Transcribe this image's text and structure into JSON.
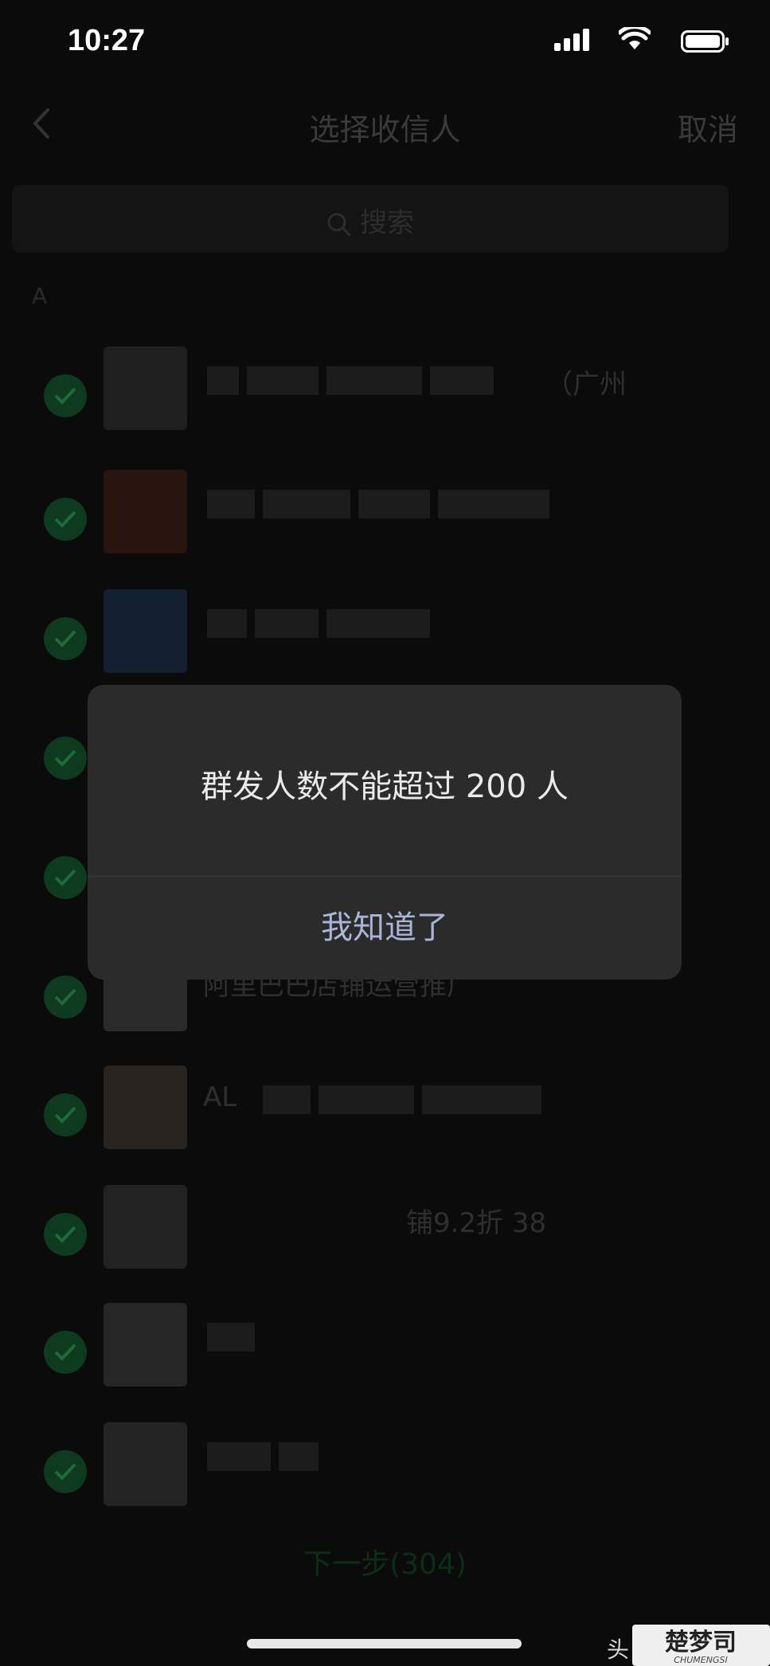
{
  "status": {
    "time": "10:27",
    "icons": [
      "cellular-signal-icon",
      "wifi-icon",
      "battery-icon"
    ]
  },
  "nav": {
    "title": "选择收信人",
    "cancel": "取消",
    "back_icon": "chevron-left-icon"
  },
  "search": {
    "placeholder": "搜索",
    "icon": "search-icon"
  },
  "section_letter": "A",
  "contacts": [
    {
      "name": "（广州",
      "checked": true
    },
    {
      "name": "",
      "checked": true
    },
    {
      "name": "",
      "checked": true
    },
    {
      "name": "",
      "checked": true
    },
    {
      "name": "",
      "checked": true
    },
    {
      "name": "阿里巴巴店铺运营推广",
      "checked": true
    },
    {
      "name": "AL",
      "checked": true
    },
    {
      "name": "铺9.2折 38",
      "checked": true
    },
    {
      "name": "",
      "checked": true
    },
    {
      "name": "",
      "checked": true
    }
  ],
  "next_step": "下一步(304)",
  "dialog": {
    "message": "群发人数不能超过 200 人",
    "button": "我知道了"
  },
  "watermark": {
    "toutiao": "头",
    "logo_text": "楚梦司",
    "logo_sub": "CHUMENGSI"
  },
  "colors": {
    "background": "#0b0b0b",
    "dialog": "#2b2b2b",
    "dialog_button": "#aab6d6",
    "check_green": "#0e3a1f"
  }
}
